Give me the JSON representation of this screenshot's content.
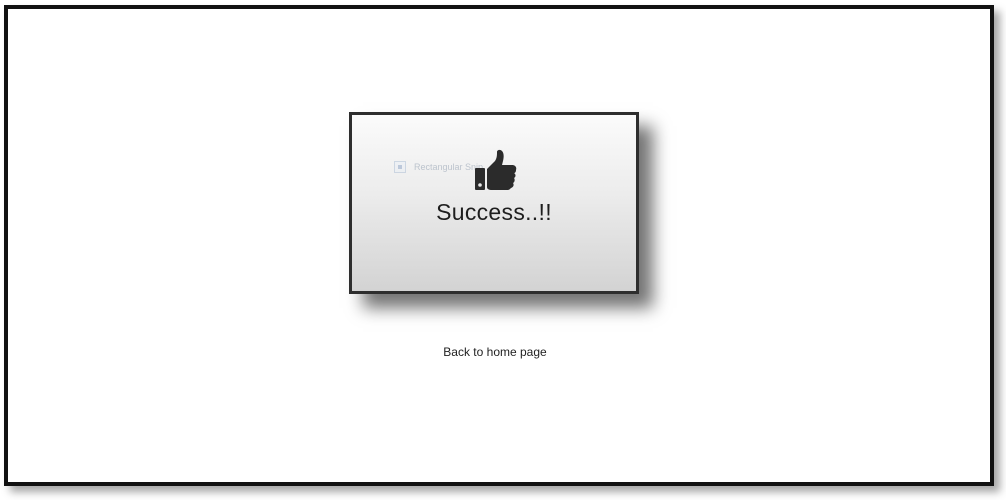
{
  "card": {
    "icon": "thumbs-up-icon",
    "title": "Success..!!",
    "ghost_tooltip_text": "Rectangular Snip"
  },
  "back_link": {
    "label": "Back to home page"
  },
  "colors": {
    "frame_border": "#111111",
    "card_border": "#2e2e2e",
    "icon": "#2b2b2b",
    "text": "#1e1e1e"
  }
}
